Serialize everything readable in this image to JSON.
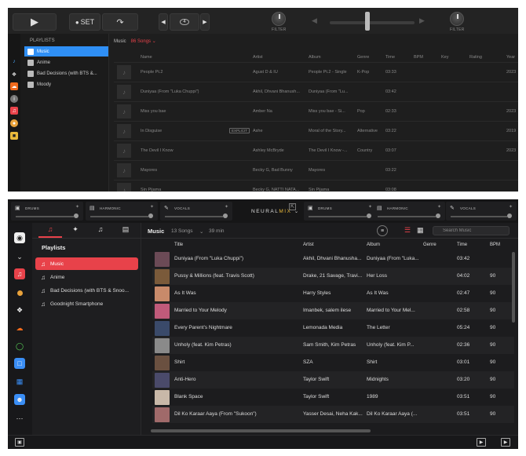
{
  "top": {
    "toolbar": {
      "set_label": "SET",
      "beat_label": "4",
      "filter_left": "FILTER",
      "filter_right": "FILTER"
    },
    "sidebar": {
      "header": "PLAYLISTS",
      "items": [
        "Music",
        "Anime",
        "Bad Decisions (with BTS &...",
        "Moody"
      ]
    },
    "main": {
      "crumb_title": "Music",
      "crumb_count": "86 Songs",
      "columns": [
        "Name",
        "Artist",
        "Album",
        "Genre",
        "Time",
        "BPM",
        "Key",
        "Rating",
        "Year"
      ],
      "rows": [
        {
          "name": "People Pt.2",
          "artist": "Agust D & IU",
          "album": "People Pt.2 - Single",
          "genre": "K-Pop",
          "time": "03:33",
          "year": "2023"
        },
        {
          "name": "Duniyaa (From \"Luka Chuppi\")",
          "artist": "Akhil, Dhvani Bhanush...",
          "album": "Duniyaa (From \"Lu...",
          "genre": "",
          "time": "03:42",
          "year": ""
        },
        {
          "name": "Miss you bae",
          "artist": "Amber Na",
          "album": "Miss you bae - Si...",
          "genre": "Pop",
          "time": "02:33",
          "year": "2023"
        },
        {
          "name": "In Disguise",
          "badge": "EXPLICIT",
          "artist": "Ashe",
          "album": "Moral of the Story...",
          "genre": "Alternative",
          "time": "03:22",
          "year": "2019"
        },
        {
          "name": "The Devil I Know",
          "artist": "Ashley McBryde",
          "album": "The Devil I Know -...",
          "genre": "Country",
          "time": "03:07",
          "year": "2023"
        },
        {
          "name": "Mayores",
          "artist": "Becky G, Bad Bunny",
          "album": "Mayores",
          "genre": "",
          "time": "03:22",
          "year": ""
        },
        {
          "name": "Sin Pijama",
          "artist": "Becky G, NATTI NATA...",
          "album": "Sin Pijama",
          "genre": "",
          "time": "03:08",
          "year": ""
        }
      ]
    }
  },
  "bottom": {
    "decks": {
      "left": [
        "DRUMS",
        "HARMONIC",
        "VOCALS"
      ],
      "right": [
        "DRUMS",
        "HARMONIC",
        "VOCALS"
      ],
      "logo_a": "NEURAL",
      "logo_b": "MIX"
    },
    "sidebar": {
      "header": "Playlists",
      "items": [
        "Music",
        "Anime",
        "Bad Decisions (with BTS & Snoo...",
        "Goodnight Smartphone"
      ]
    },
    "main": {
      "title": "Music",
      "count": "13 Songs",
      "duration": "39 min",
      "search_placeholder": "Search Music",
      "columns": [
        "Title",
        "Artist",
        "Album",
        "Genre",
        "Time",
        "BPM"
      ],
      "rows": [
        {
          "title": "Duniyaa (From \"Luka Chuppi\")",
          "artist": "Akhil, Dhvani Bhanusha...",
          "album": "Duniyaa (From \"Luka...",
          "time": "03:42",
          "bpm": "",
          "art": "#6b4a56"
        },
        {
          "title": "Pussy & Millions (feat. Travis Scott)",
          "artist": "Drake, 21 Savage, Travi...",
          "album": "Her Loss",
          "time": "04:02",
          "bpm": "90",
          "art": "#7a5a3a"
        },
        {
          "title": "As It Was",
          "artist": "Harry Styles",
          "album": "As It Was",
          "time": "02:47",
          "bpm": "90",
          "art": "#c88a6a"
        },
        {
          "title": "Married to Your Melody",
          "artist": "Imanbek, salem ilese",
          "album": "Married to Your Mel...",
          "time": "02:58",
          "bpm": "90",
          "art": "#c05a7a"
        },
        {
          "title": "Every Parent's Nightmare",
          "artist": "Lemonada Media",
          "album": "The Letter",
          "time": "05:24",
          "bpm": "90",
          "art": "#3a4a6a"
        },
        {
          "title": "Unholy (feat. Kim Petras)",
          "artist": "Sam Smith, Kim Petras",
          "album": "Unholy (feat. Kim P...",
          "time": "02:36",
          "bpm": "90",
          "art": "#8a8a8a"
        },
        {
          "title": "Shirt",
          "artist": "SZA",
          "album": "Shirt",
          "time": "03:01",
          "bpm": "90",
          "art": "#6a5040"
        },
        {
          "title": "Anti-Hero",
          "artist": "Taylor Swift",
          "album": "Midnights",
          "time": "03:20",
          "bpm": "90",
          "art": "#4a4a6a"
        },
        {
          "title": "Blank Space",
          "artist": "Taylor Swift",
          "album": "1989",
          "time": "03:51",
          "bpm": "90",
          "art": "#c8b8a8"
        },
        {
          "title": "Dil Ko Karaar Aaya (From \"Sukoon\")",
          "artist": "Yasser Desai, Neha Kak...",
          "album": "Dil Ko Karaar Aaya (...",
          "time": "03:51",
          "bpm": "90",
          "art": "#a06a6a"
        }
      ]
    }
  }
}
